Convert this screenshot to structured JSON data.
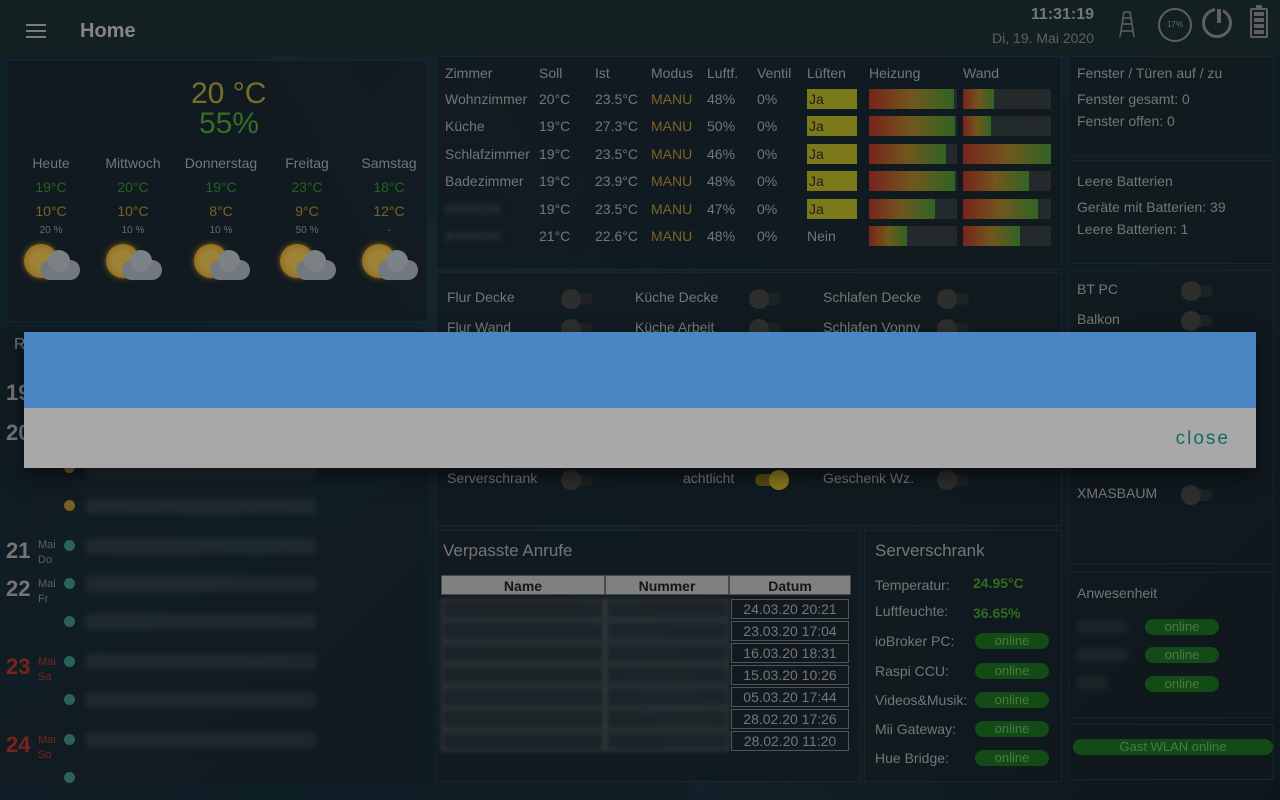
{
  "header": {
    "title": "Home",
    "time": "11:31:19",
    "date": "Di, 19. Mai 2020",
    "cpu_badge": "17%",
    "icons": [
      "menu-icon",
      "tower-icon",
      "power-icon",
      "battery-icon"
    ]
  },
  "weather": {
    "temperature": "20 °C",
    "humidity": "55%",
    "days": [
      {
        "name": "Heute",
        "high": "19°C",
        "low": "10°C",
        "precip": "20 %"
      },
      {
        "name": "Mittwoch",
        "high": "20°C",
        "low": "10°C",
        "precip": "10 %"
      },
      {
        "name": "Donnerstag",
        "high": "19°C",
        "low": "8°C",
        "precip": "10 %"
      },
      {
        "name": "Freitag",
        "high": "23°C",
        "low": "9°C",
        "precip": "50 %"
      },
      {
        "name": "Samstag",
        "high": "18°C",
        "low": "12°C",
        "precip": "-"
      }
    ]
  },
  "rooms": {
    "columns": [
      "Zimmer",
      "Soll",
      "Ist",
      "Modus",
      "Luftf.",
      "Ventil",
      "Lüften",
      "Heizung",
      "Wand"
    ],
    "rows": [
      {
        "name": "Wohnzimmer",
        "soll": "20°C",
        "ist": "23.5°C",
        "modus": "MANU",
        "luftf": "48%",
        "ventil": "0%",
        "lueften": "Ja",
        "heizung": 0.97,
        "wand": 0.35
      },
      {
        "name": "Küche",
        "soll": "19°C",
        "ist": "27.3°C",
        "modus": "MANU",
        "luftf": "50%",
        "ventil": "0%",
        "lueften": "Ja",
        "heizung": 0.98,
        "wand": 0.32
      },
      {
        "name": "Schlafzimmer",
        "soll": "19°C",
        "ist": "23.5°C",
        "modus": "MANU",
        "luftf": "46%",
        "ventil": "0%",
        "lueften": "Ja",
        "heizung": 0.87,
        "wand": 1.0
      },
      {
        "name": "Badezimmer",
        "soll": "19°C",
        "ist": "23.9°C",
        "modus": "MANU",
        "luftf": "48%",
        "ventil": "0%",
        "lueften": "Ja",
        "heizung": 0.98,
        "wand": 0.75
      },
      {
        "name": "",
        "soll": "19°C",
        "ist": "23.5°C",
        "modus": "MANU",
        "luftf": "47%",
        "ventil": "0%",
        "lueften": "Ja",
        "heizung": 0.75,
        "wand": 0.85
      },
      {
        "name": "",
        "soll": "21°C",
        "ist": "22.6°C",
        "modus": "MANU",
        "luftf": "48%",
        "ventil": "0%",
        "lueften": "Nein",
        "heizung": 0.43,
        "wand": 0.65
      }
    ]
  },
  "switches": {
    "items": [
      {
        "label": "Flur Decke",
        "on": false
      },
      {
        "label": "Küche Decke",
        "on": false
      },
      {
        "label": "Schlafen Decke",
        "on": false
      },
      {
        "label": "Flur Wand",
        "on": false
      },
      {
        "label": "Küche Arbeit",
        "on": false
      },
      {
        "label": "Schlafen Vonny",
        "on": false
      },
      {
        "label": "Serverschrank",
        "on": false
      },
      {
        "label": "achtlicht",
        "on": true
      },
      {
        "label": "Geschenk Wz.",
        "on": false
      }
    ]
  },
  "fenster": {
    "title": "Fenster / Türen auf / zu",
    "gesamt": "Fenster gesamt: 0",
    "offen": "Fenster offen: 0"
  },
  "batterien": {
    "title": "Leere Batterien",
    "mit": "Geräte mit Batterien: 39",
    "leer": "Leere Batterien: 1"
  },
  "right_switches": {
    "items": [
      {
        "label": "BT PC"
      },
      {
        "label": "Balkon"
      },
      {
        "label": "XMASBAUM"
      }
    ]
  },
  "anwesenheit": {
    "title": "Anwesenheit",
    "status": [
      "online",
      "online",
      "online"
    ]
  },
  "gast_wlan": "Gast WLAN online",
  "calendar": {
    "days": [
      {
        "num": "19",
        "top": true
      },
      {
        "num": "20",
        "top": true
      },
      {
        "num": "21",
        "month": "Mai",
        "weekday": "Do",
        "red": false
      },
      {
        "num": "22",
        "month": "Mai",
        "weekday": "Fr",
        "red": false
      },
      {
        "num": "23",
        "month": "Mai",
        "weekday": "Sa",
        "red": true
      },
      {
        "num": "24",
        "month": "Mai",
        "weekday": "So",
        "red": true
      }
    ],
    "partial_label": "R"
  },
  "anrufe": {
    "title": "Verpasste Anrufe",
    "columns": [
      "Name",
      "Nummer",
      "Datum"
    ],
    "dates": [
      "24.03.20 20:21",
      "23.03.20 17:04",
      "16.03.20 18:31",
      "15.03.20 10:26",
      "05.03.20 17:44",
      "28.02.20 17:26",
      "28.02.20 11:20"
    ]
  },
  "server": {
    "title": "Serverschrank",
    "temperatur_label": "Temperatur:",
    "temperatur": "24.95°C",
    "luftfeuchte_label": "Luftfeuchte:",
    "luftfeuchte": "36.65%",
    "devices": [
      {
        "label": "ioBroker PC:",
        "status": "online"
      },
      {
        "label": "Raspi CCU:",
        "status": "online"
      },
      {
        "label": "Videos&Musik:",
        "status": "online"
      },
      {
        "label": "Mii Gateway:",
        "status": "online"
      },
      {
        "label": "Hue Bridge:",
        "status": "online"
      }
    ]
  },
  "dialog": {
    "close_label": "close",
    "header_color": "#4a86c4",
    "body_color": "#a8a8a8"
  }
}
